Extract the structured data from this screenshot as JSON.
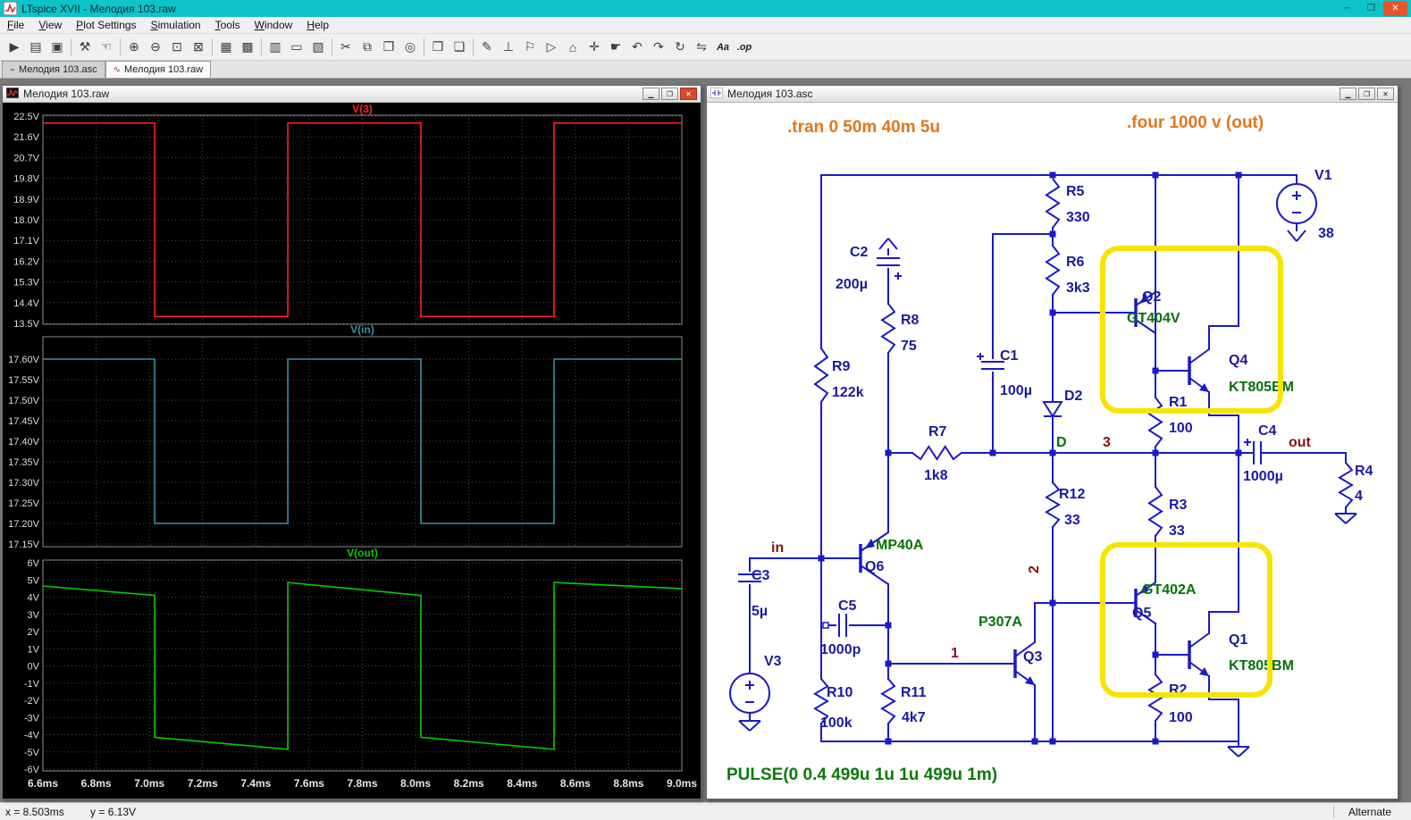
{
  "window": {
    "title": "LTspice XVII - Мелодия 103.raw",
    "controls": {
      "minimize": "─",
      "maximize": "❐",
      "close": "✕"
    }
  },
  "menu": {
    "items": [
      {
        "id": "file",
        "label": "File"
      },
      {
        "id": "view",
        "label": "View"
      },
      {
        "id": "plot-settings",
        "label": "Plot Settings"
      },
      {
        "id": "simulation",
        "label": "Simulation"
      },
      {
        "id": "tools",
        "label": "Tools"
      },
      {
        "id": "window",
        "label": "Window"
      },
      {
        "id": "help",
        "label": "Help"
      }
    ]
  },
  "toolbar": {
    "icons": [
      {
        "name": "run",
        "glyph": "▶"
      },
      {
        "name": "open-folder",
        "glyph": "▤"
      },
      {
        "name": "save",
        "glyph": "▣"
      },
      {
        "sep": true
      },
      {
        "name": "control-panel",
        "glyph": "⚒"
      },
      {
        "name": "pan-hand",
        "glyph": "☜"
      },
      {
        "sep": true
      },
      {
        "name": "zoom-in",
        "glyph": "⊕"
      },
      {
        "name": "zoom-out",
        "glyph": "⊖"
      },
      {
        "name": "zoom-area",
        "glyph": "⊡"
      },
      {
        "name": "zoom-fit",
        "glyph": "⊠"
      },
      {
        "sep": true
      },
      {
        "name": "grid",
        "glyph": "▦"
      },
      {
        "name": "mark-data-points",
        "glyph": "▩"
      },
      {
        "sep": true
      },
      {
        "name": "tile-vertical",
        "glyph": "▥"
      },
      {
        "name": "tile-horizontal",
        "glyph": "▭"
      },
      {
        "name": "cascade-windows",
        "glyph": "▧"
      },
      {
        "sep": true
      },
      {
        "name": "cut",
        "glyph": "✂"
      },
      {
        "name": "copy",
        "glyph": "⧉"
      },
      {
        "name": "paste",
        "glyph": "❐"
      },
      {
        "name": "find",
        "glyph": "◎"
      },
      {
        "sep": true
      },
      {
        "name": "print",
        "glyph": "❒"
      },
      {
        "name": "print-preview",
        "glyph": "❑"
      },
      {
        "sep": true
      },
      {
        "name": "draw-wire",
        "glyph": "✎"
      },
      {
        "name": "place-ground",
        "glyph": "⊥"
      },
      {
        "name": "place-label",
        "glyph": "⚐"
      },
      {
        "name": "place-diode",
        "glyph": "▷"
      },
      {
        "name": "place-component",
        "glyph": "⌂"
      },
      {
        "name": "move",
        "glyph": "✛"
      },
      {
        "name": "drag",
        "glyph": "☛"
      },
      {
        "name": "undo",
        "glyph": "↶"
      },
      {
        "name": "redo",
        "glyph": "↷"
      },
      {
        "name": "rotate",
        "glyph": "↻"
      },
      {
        "name": "mirror",
        "glyph": "⇋"
      },
      {
        "name": "text-tool",
        "glyph": "Aa"
      },
      {
        "name": "spice-directive",
        "glyph": ".op"
      }
    ]
  },
  "tabs": {
    "items": [
      {
        "icon_name": "schematic-file-icon",
        "icon": "⌁",
        "label": "Мелодия 103.asc",
        "active": false
      },
      {
        "icon_name": "waveform-file-icon",
        "icon": "∿",
        "label": "Мелодия 103.raw",
        "active": true
      }
    ]
  },
  "waveform_window": {
    "title": "Мелодия 103.raw",
    "controls": {
      "minimize": "▁",
      "maximize": "❐",
      "close": "✕"
    }
  },
  "schematic_window": {
    "title": "Мелодия 103.asc",
    "controls": {
      "minimize": "▁",
      "maximize": "❐",
      "close": "✕"
    }
  },
  "status_bar": {
    "cursor_x": "x = 8.503ms",
    "cursor_y": "y = 6.13V",
    "mode": "Alternate"
  },
  "colors": {
    "titlebar": "#0ec4c9",
    "wire": "#1a1ac8",
    "net_label": "#8c1010",
    "comment": "#e2761b",
    "directive": "#0a7a0a",
    "highlight": "#f6e400",
    "trace_v3": "#ff2020",
    "trace_vin": "#3b8ea5",
    "trace_vout": "#00d000"
  },
  "schematic": {
    "labels": {
      "directive_tran": ".tran 0 50m 40m 5u",
      "directive_four": ".four 1000 v (out)",
      "pulse": "PULSE(0 0.4 499u 1u 1u 499u 1m)",
      "v1": "V1",
      "v1_value": "38",
      "v3": "V3",
      "r1": "R1",
      "r1_value": "100",
      "r2": "R2",
      "r2_value": "100",
      "r3": "R3",
      "r3_value": "33",
      "r4": "R4",
      "r4_value": "4",
      "r5": "R5",
      "r5_value": "330",
      "r6": "R6",
      "r6_value": "3k3",
      "r7": "R7",
      "r7_value": "1k8",
      "r8": "R8",
      "r8_value": "75",
      "r9": "R9",
      "r9_value": "122k",
      "r10": "R10",
      "r10_value": "100k",
      "r11": "R11",
      "r11_value": "4k7",
      "r12": "R12",
      "r12_value": "33",
      "c1": "C1",
      "c1_value": "100µ",
      "c2": "C2",
      "c2_value": "200µ",
      "c3": "C3",
      "c3_value": "5µ",
      "c4": "C4",
      "c4_value": "1000µ",
      "c5": "C5",
      "c5_value": "1000p",
      "d2": "D2",
      "d2_value": "D",
      "q1": "Q1",
      "q1_value": "KT805BM",
      "q2": "Q2",
      "q2_value": "GT404V",
      "q3": "Q3",
      "q3_value": "P307A",
      "q4": "Q4",
      "q4_value": "KT805BM",
      "q5": "Q5",
      "q5_value": "GT402A",
      "q6": "Q6",
      "q6_value": "MP40A",
      "net_in": "in",
      "net_out": "out",
      "net_1": "1",
      "net_2": "2",
      "net_3": "3"
    }
  },
  "chart_data": {
    "type": "line",
    "x_unit": "ms",
    "x_ticks": {
      "values": [
        6.6,
        6.8,
        7.0,
        7.2,
        7.4,
        7.6,
        7.8,
        8.0,
        8.2,
        8.4,
        8.6,
        8.8,
        9.0
      ],
      "labels": [
        "6.6ms",
        "6.8ms",
        "7.0ms",
        "7.2ms",
        "7.4ms",
        "7.6ms",
        "7.8ms",
        "8.0ms",
        "8.2ms",
        "8.4ms",
        "8.6ms",
        "8.8ms",
        "9.0ms"
      ]
    },
    "panes": [
      {
        "title": "V(3)",
        "color": "#ff2020",
        "y_ticks": {
          "labels": [
            "22.5V",
            "21.6V",
            "20.7V",
            "19.8V",
            "18.9V",
            "18.0V",
            "17.1V",
            "16.2V",
            "15.3V",
            "14.4V",
            "13.5V"
          ],
          "values": [
            22.5,
            21.6,
            20.7,
            19.8,
            18.9,
            18.0,
            17.1,
            16.2,
            15.3,
            14.4,
            13.5
          ]
        },
        "points": [
          [
            6.6,
            22.2
          ],
          [
            7.02,
            22.2
          ],
          [
            7.02,
            13.8
          ],
          [
            7.52,
            13.8
          ],
          [
            7.52,
            22.2
          ],
          [
            8.02,
            22.2
          ],
          [
            8.02,
            13.8
          ],
          [
            8.52,
            13.8
          ],
          [
            8.52,
            22.2
          ],
          [
            9.0,
            22.2
          ]
        ]
      },
      {
        "title": "V(in)",
        "color": "#3b8ea5",
        "y_ticks": {
          "labels": [
            "17.60V",
            "17.55V",
            "17.50V",
            "17.45V",
            "17.40V",
            "17.35V",
            "17.30V",
            "17.25V",
            "17.20V",
            "17.15V"
          ],
          "values": [
            17.6,
            17.55,
            17.5,
            17.45,
            17.4,
            17.35,
            17.3,
            17.25,
            17.2,
            17.15
          ]
        },
        "points": [
          [
            6.6,
            17.6
          ],
          [
            7.02,
            17.6
          ],
          [
            7.02,
            17.2
          ],
          [
            7.52,
            17.2
          ],
          [
            7.52,
            17.6
          ],
          [
            8.02,
            17.6
          ],
          [
            8.02,
            17.2
          ],
          [
            8.52,
            17.2
          ],
          [
            8.52,
            17.6
          ],
          [
            9.0,
            17.6
          ]
        ]
      },
      {
        "title": "V(out)",
        "color": "#00d000",
        "y_ticks": {
          "labels": [
            "6V",
            "5V",
            "4V",
            "3V",
            "2V",
            "1V",
            "0V",
            "-1V",
            "-2V",
            "-3V",
            "-4V",
            "-5V",
            "-6V"
          ],
          "values": [
            6,
            5,
            4,
            3,
            2,
            1,
            0,
            -1,
            -2,
            -3,
            -4,
            -5,
            -6
          ]
        },
        "points": [
          [
            6.6,
            4.65
          ],
          [
            7.02,
            4.1
          ],
          [
            7.02,
            -4.15
          ],
          [
            7.52,
            -4.85
          ],
          [
            7.52,
            4.85
          ],
          [
            8.02,
            4.1
          ],
          [
            8.02,
            -4.15
          ],
          [
            8.52,
            -4.85
          ],
          [
            8.52,
            4.85
          ],
          [
            9.0,
            4.5
          ]
        ]
      }
    ]
  }
}
